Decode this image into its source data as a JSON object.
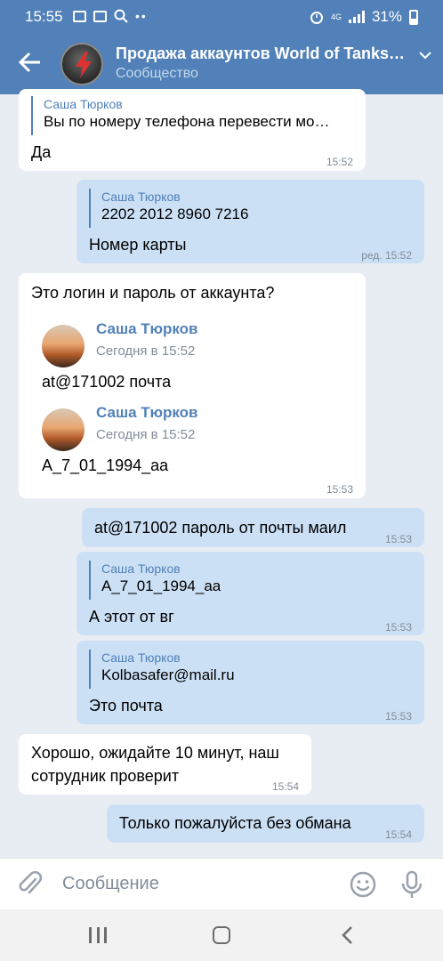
{
  "status": {
    "time": "15:55",
    "net": "4G",
    "battery": "31%"
  },
  "header": {
    "title": "Продажа аккаунтов World of Tanks…",
    "subtitle": "Сообщество"
  },
  "messages": [
    {
      "quote_name": "Саша Тюрков",
      "quote_text": "Вы по номеру телефона перевести мо…",
      "text": "Да",
      "time": "15:52"
    },
    {
      "quote_name": "Саша Тюрков",
      "quote_text": "2202 2012 8960 7216",
      "text": "Номер карты",
      "time": "ред. 15:52"
    },
    {
      "text": "Это логин и пароль от аккаунта?",
      "time": "15:53",
      "forwards": [
        {
          "name": "Саша Тюрков",
          "date": "Сегодня в 15:52",
          "text": "at@171002 почта"
        },
        {
          "name": "Саша Тюрков",
          "date": "Сегодня в 15:52",
          "text": "A_7_01_1994_aa"
        }
      ]
    },
    {
      "text": "at@171002  пароль от почты маил",
      "time": "15:53"
    },
    {
      "quote_name": "Саша Тюрков",
      "quote_text": "A_7_01_1994_aa",
      "text": "А этот от вг",
      "time": "15:53"
    },
    {
      "quote_name": "Саша Тюрков",
      "quote_text": "Kolbasafer@mail.ru",
      "text": "Это почта",
      "time": "15:53"
    },
    {
      "text_line1": "Хорошо, ожидайте 10 минут, наш",
      "text_line2": "сотрудник проверит",
      "time": "15:54"
    },
    {
      "text": "Только пожалуйста без обмана",
      "time": "15:54"
    }
  ],
  "composer": {
    "placeholder": "Сообщение"
  },
  "icons": {
    "back": "arrow-left-icon",
    "attach": "paperclip-icon",
    "emoji": "smile-icon",
    "mic": "microphone-icon",
    "nav_recent": "recent-apps-icon",
    "nav_home": "home-icon",
    "nav_back": "chevron-left-icon"
  },
  "colors": {
    "header": "#5181b8",
    "background": "#e8edf3",
    "outgoing": "#cce0f5",
    "incoming": "#ffffff",
    "accent": "#5181b8"
  }
}
